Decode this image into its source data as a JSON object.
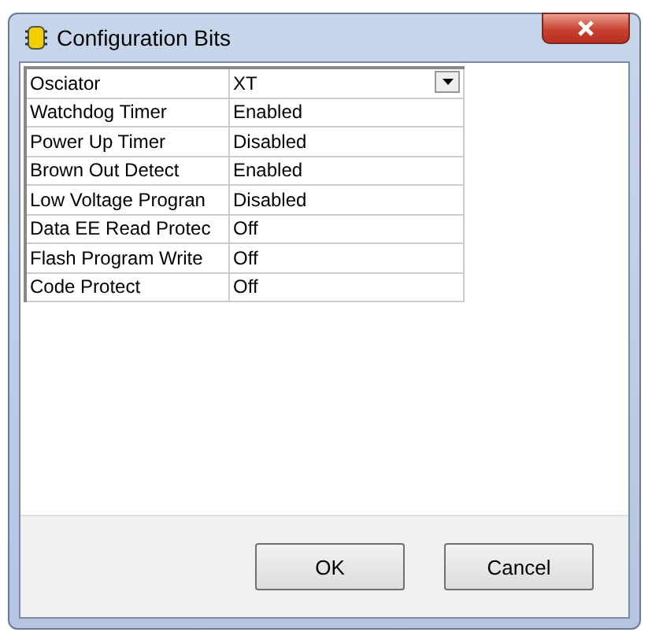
{
  "window": {
    "title": "Configuration Bits"
  },
  "table": {
    "rows": [
      {
        "kind": "dropdown",
        "name": "Osciator",
        "value": "XT"
      },
      {
        "kind": "text",
        "name": "Watchdog Timer",
        "value": "Enabled"
      },
      {
        "kind": "text",
        "name": "Power Up Timer",
        "value": "Disabled"
      },
      {
        "kind": "text",
        "name": "Brown Out Detect",
        "value": "Enabled"
      },
      {
        "kind": "text",
        "name": "Low Voltage Progran",
        "value": "Disabled"
      },
      {
        "kind": "text",
        "name": "Data EE Read Protec",
        "value": "Off"
      },
      {
        "kind": "text",
        "name": "Flash Program Write",
        "value": "Off"
      },
      {
        "kind": "text",
        "name": "Code Protect",
        "value": "Off"
      }
    ]
  },
  "buttons": [
    "OK",
    "Cancel"
  ]
}
